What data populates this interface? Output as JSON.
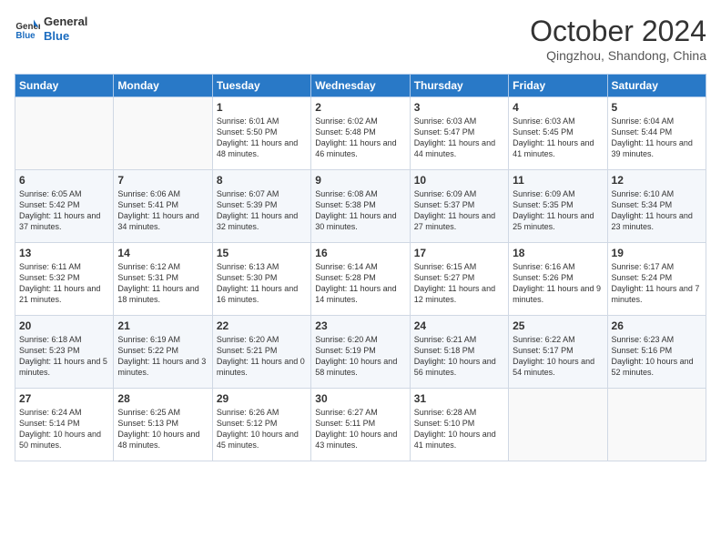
{
  "header": {
    "logo_line1": "General",
    "logo_line2": "Blue",
    "month": "October 2024",
    "location": "Qingzhou, Shandong, China"
  },
  "weekdays": [
    "Sunday",
    "Monday",
    "Tuesday",
    "Wednesday",
    "Thursday",
    "Friday",
    "Saturday"
  ],
  "weeks": [
    [
      {
        "day": "",
        "info": ""
      },
      {
        "day": "",
        "info": ""
      },
      {
        "day": "1",
        "info": "Sunrise: 6:01 AM\nSunset: 5:50 PM\nDaylight: 11 hours and 48 minutes."
      },
      {
        "day": "2",
        "info": "Sunrise: 6:02 AM\nSunset: 5:48 PM\nDaylight: 11 hours and 46 minutes."
      },
      {
        "day": "3",
        "info": "Sunrise: 6:03 AM\nSunset: 5:47 PM\nDaylight: 11 hours and 44 minutes."
      },
      {
        "day": "4",
        "info": "Sunrise: 6:03 AM\nSunset: 5:45 PM\nDaylight: 11 hours and 41 minutes."
      },
      {
        "day": "5",
        "info": "Sunrise: 6:04 AM\nSunset: 5:44 PM\nDaylight: 11 hours and 39 minutes."
      }
    ],
    [
      {
        "day": "6",
        "info": "Sunrise: 6:05 AM\nSunset: 5:42 PM\nDaylight: 11 hours and 37 minutes."
      },
      {
        "day": "7",
        "info": "Sunrise: 6:06 AM\nSunset: 5:41 PM\nDaylight: 11 hours and 34 minutes."
      },
      {
        "day": "8",
        "info": "Sunrise: 6:07 AM\nSunset: 5:39 PM\nDaylight: 11 hours and 32 minutes."
      },
      {
        "day": "9",
        "info": "Sunrise: 6:08 AM\nSunset: 5:38 PM\nDaylight: 11 hours and 30 minutes."
      },
      {
        "day": "10",
        "info": "Sunrise: 6:09 AM\nSunset: 5:37 PM\nDaylight: 11 hours and 27 minutes."
      },
      {
        "day": "11",
        "info": "Sunrise: 6:09 AM\nSunset: 5:35 PM\nDaylight: 11 hours and 25 minutes."
      },
      {
        "day": "12",
        "info": "Sunrise: 6:10 AM\nSunset: 5:34 PM\nDaylight: 11 hours and 23 minutes."
      }
    ],
    [
      {
        "day": "13",
        "info": "Sunrise: 6:11 AM\nSunset: 5:32 PM\nDaylight: 11 hours and 21 minutes."
      },
      {
        "day": "14",
        "info": "Sunrise: 6:12 AM\nSunset: 5:31 PM\nDaylight: 11 hours and 18 minutes."
      },
      {
        "day": "15",
        "info": "Sunrise: 6:13 AM\nSunset: 5:30 PM\nDaylight: 11 hours and 16 minutes."
      },
      {
        "day": "16",
        "info": "Sunrise: 6:14 AM\nSunset: 5:28 PM\nDaylight: 11 hours and 14 minutes."
      },
      {
        "day": "17",
        "info": "Sunrise: 6:15 AM\nSunset: 5:27 PM\nDaylight: 11 hours and 12 minutes."
      },
      {
        "day": "18",
        "info": "Sunrise: 6:16 AM\nSunset: 5:26 PM\nDaylight: 11 hours and 9 minutes."
      },
      {
        "day": "19",
        "info": "Sunrise: 6:17 AM\nSunset: 5:24 PM\nDaylight: 11 hours and 7 minutes."
      }
    ],
    [
      {
        "day": "20",
        "info": "Sunrise: 6:18 AM\nSunset: 5:23 PM\nDaylight: 11 hours and 5 minutes."
      },
      {
        "day": "21",
        "info": "Sunrise: 6:19 AM\nSunset: 5:22 PM\nDaylight: 11 hours and 3 minutes."
      },
      {
        "day": "22",
        "info": "Sunrise: 6:20 AM\nSunset: 5:21 PM\nDaylight: 11 hours and 0 minutes."
      },
      {
        "day": "23",
        "info": "Sunrise: 6:20 AM\nSunset: 5:19 PM\nDaylight: 10 hours and 58 minutes."
      },
      {
        "day": "24",
        "info": "Sunrise: 6:21 AM\nSunset: 5:18 PM\nDaylight: 10 hours and 56 minutes."
      },
      {
        "day": "25",
        "info": "Sunrise: 6:22 AM\nSunset: 5:17 PM\nDaylight: 10 hours and 54 minutes."
      },
      {
        "day": "26",
        "info": "Sunrise: 6:23 AM\nSunset: 5:16 PM\nDaylight: 10 hours and 52 minutes."
      }
    ],
    [
      {
        "day": "27",
        "info": "Sunrise: 6:24 AM\nSunset: 5:14 PM\nDaylight: 10 hours and 50 minutes."
      },
      {
        "day": "28",
        "info": "Sunrise: 6:25 AM\nSunset: 5:13 PM\nDaylight: 10 hours and 48 minutes."
      },
      {
        "day": "29",
        "info": "Sunrise: 6:26 AM\nSunset: 5:12 PM\nDaylight: 10 hours and 45 minutes."
      },
      {
        "day": "30",
        "info": "Sunrise: 6:27 AM\nSunset: 5:11 PM\nDaylight: 10 hours and 43 minutes."
      },
      {
        "day": "31",
        "info": "Sunrise: 6:28 AM\nSunset: 5:10 PM\nDaylight: 10 hours and 41 minutes."
      },
      {
        "day": "",
        "info": ""
      },
      {
        "day": "",
        "info": ""
      }
    ]
  ]
}
